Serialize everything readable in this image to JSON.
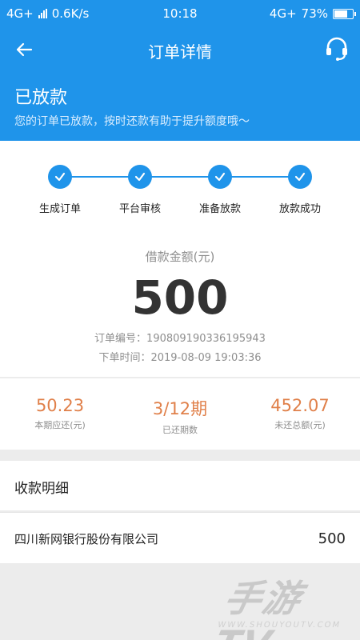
{
  "status_bar": {
    "network_label": "4G+",
    "speed": "0.6K/s",
    "time": "10:18",
    "network_right": "4G+",
    "battery": "73%",
    "battery_level": 0.73
  },
  "nav": {
    "back_icon": "arrow-left-icon",
    "title": "订单详情",
    "support_icon": "headset-icon"
  },
  "status": {
    "title": "已放款",
    "description": "您的订单已放款，按时还款有助于提升额度哦～"
  },
  "steps": [
    {
      "label": "生成订单",
      "done": true
    },
    {
      "label": "平台审核",
      "done": true
    },
    {
      "label": "准备放款",
      "done": true
    },
    {
      "label": "放款成功",
      "done": true
    }
  ],
  "loan": {
    "amount_label": "借款金额(元)",
    "amount": "500",
    "order_no": "订单编号：190809190336195943",
    "order_time": "下单时间：2019-08-09 19:03:36"
  },
  "summary": [
    {
      "value": "50.23",
      "label": "本期应还(元)"
    },
    {
      "value": "3/12期",
      "label": "已还期数"
    },
    {
      "value": "452.07",
      "label": "未还总额(元)"
    }
  ],
  "receipt": {
    "section_title": "收款明细",
    "bank_name": "四川新网银行股份有限公司",
    "amount": "500"
  },
  "watermark": {
    "text": "手游TV",
    "sub": "WWW.SHOUYOUTV.COM"
  },
  "colors": {
    "primary": "#1f94ea",
    "accent": "#e0804a"
  }
}
